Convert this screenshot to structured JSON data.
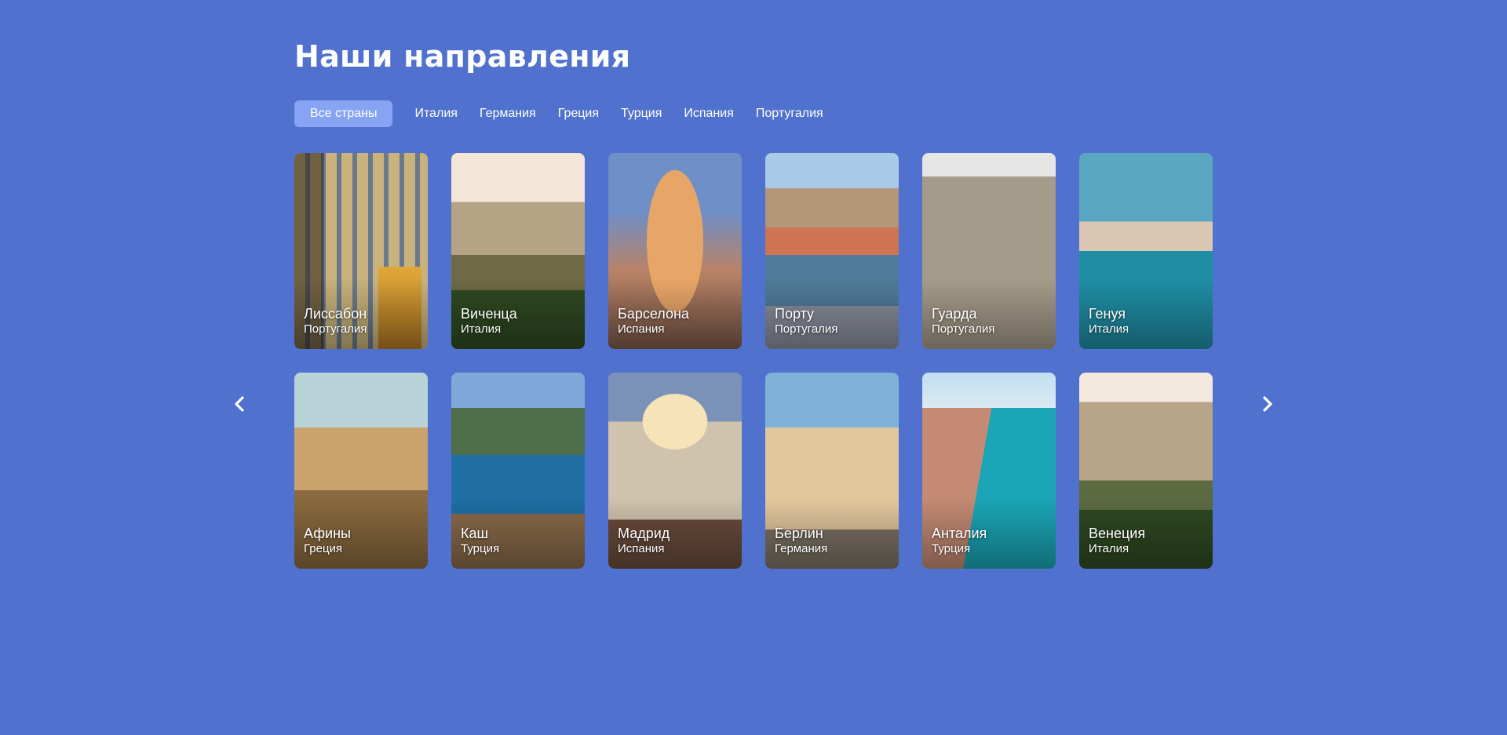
{
  "title": "Наши направления",
  "filters": {
    "active_index": 0,
    "items": [
      "Все страны",
      "Италия",
      "Германия",
      "Греция",
      "Турция",
      "Испания",
      "Португалия"
    ]
  },
  "cards": [
    {
      "city": "Лиссабон",
      "country": "Португалия"
    },
    {
      "city": "Виченца",
      "country": "Италия"
    },
    {
      "city": "Барселона",
      "country": "Испания"
    },
    {
      "city": "Порту",
      "country": "Португалия"
    },
    {
      "city": "Гуарда",
      "country": "Португалия"
    },
    {
      "city": "Генуя",
      "country": "Италия"
    },
    {
      "city": "Афины",
      "country": "Греция"
    },
    {
      "city": "Каш",
      "country": "Турция"
    },
    {
      "city": "Мадрид",
      "country": "Испания"
    },
    {
      "city": "Берлин",
      "country": "Германия"
    },
    {
      "city": "Анталия",
      "country": "Турция"
    },
    {
      "city": "Венеция",
      "country": "Италия"
    }
  ],
  "colors": {
    "background": "#5072ce",
    "active_chip": "#86a4f3",
    "text": "#ffffff"
  },
  "icons": {
    "prev": "chevron-left-icon",
    "next": "chevron-right-icon"
  }
}
